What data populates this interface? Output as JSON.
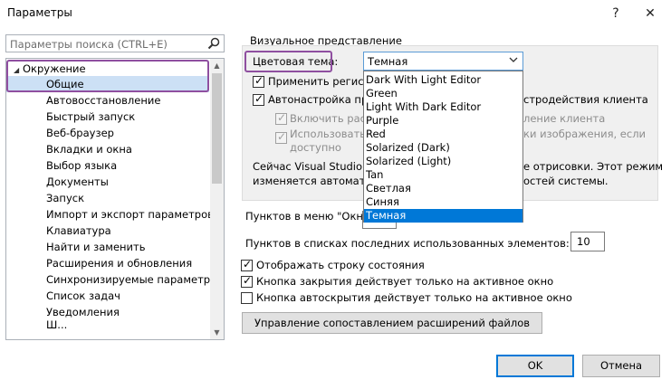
{
  "window": {
    "title": "Параметры",
    "help": "?",
    "close": "✕"
  },
  "search": {
    "placeholder": "Параметры поиска (CTRL+E)"
  },
  "tree": {
    "root": "Окружение",
    "selected": "Общие",
    "items": [
      "Автовосстановление",
      "Быстрый запуск",
      "Веб-браузер",
      "Вкладки и окна",
      "Выбор языка",
      "Документы",
      "Запуск",
      "Импорт и экспорт параметров",
      "Клавиатура",
      "Найти и заменить",
      "Расширения и обновления",
      "Синхронизируемые параметры",
      "Список задач",
      "Уведомления",
      "Ш..."
    ]
  },
  "visual": {
    "section_title": "Визуальное представление",
    "color_theme_label": "Цветовая тема:",
    "color_theme_value": "Темная",
    "check1": "Применить регистр",
    "check2": "Автонастройка пре",
    "check2_tail": "стродействия клиента",
    "sub1": "Включить рас",
    "sub1_tail": "ление клиента",
    "sub2": "Использовать а",
    "sub2_tail": "ки изображения, если",
    "sub2_line2": "доступно",
    "info1": "Сейчас Visual Studio ис",
    "info1_tail": "е отрисовки. Этот режим",
    "info2": "изменяется автоматич",
    "info2_tail": "остей системы."
  },
  "theme_options": [
    "Dark With Light Editor",
    "Green",
    "Light With Dark Editor",
    "Purple",
    "Red",
    "Solarized (Dark)",
    "Solarized (Light)",
    "Tan",
    "Светлая",
    "Синяя",
    "Темная"
  ],
  "window_menu": {
    "label": "Пунктов в меню \"Окно\""
  },
  "mru": {
    "label": "Пунктов в списках последних использованных элементов:",
    "value": "10"
  },
  "options": {
    "status_bar": "Отображать строку состояния",
    "close_btn": "Кнопка закрытия действует только на активное окно",
    "autohide_btn": "Кнопка автоскрытия действует только на активное окно"
  },
  "buttons": {
    "manage": "Управление сопоставлением расширений файлов",
    "ok": "OK",
    "cancel": "Отмена"
  },
  "colors": {
    "accent": "#0078d7",
    "highlight": "#8f4fa0",
    "selection": "#cce0f5"
  }
}
